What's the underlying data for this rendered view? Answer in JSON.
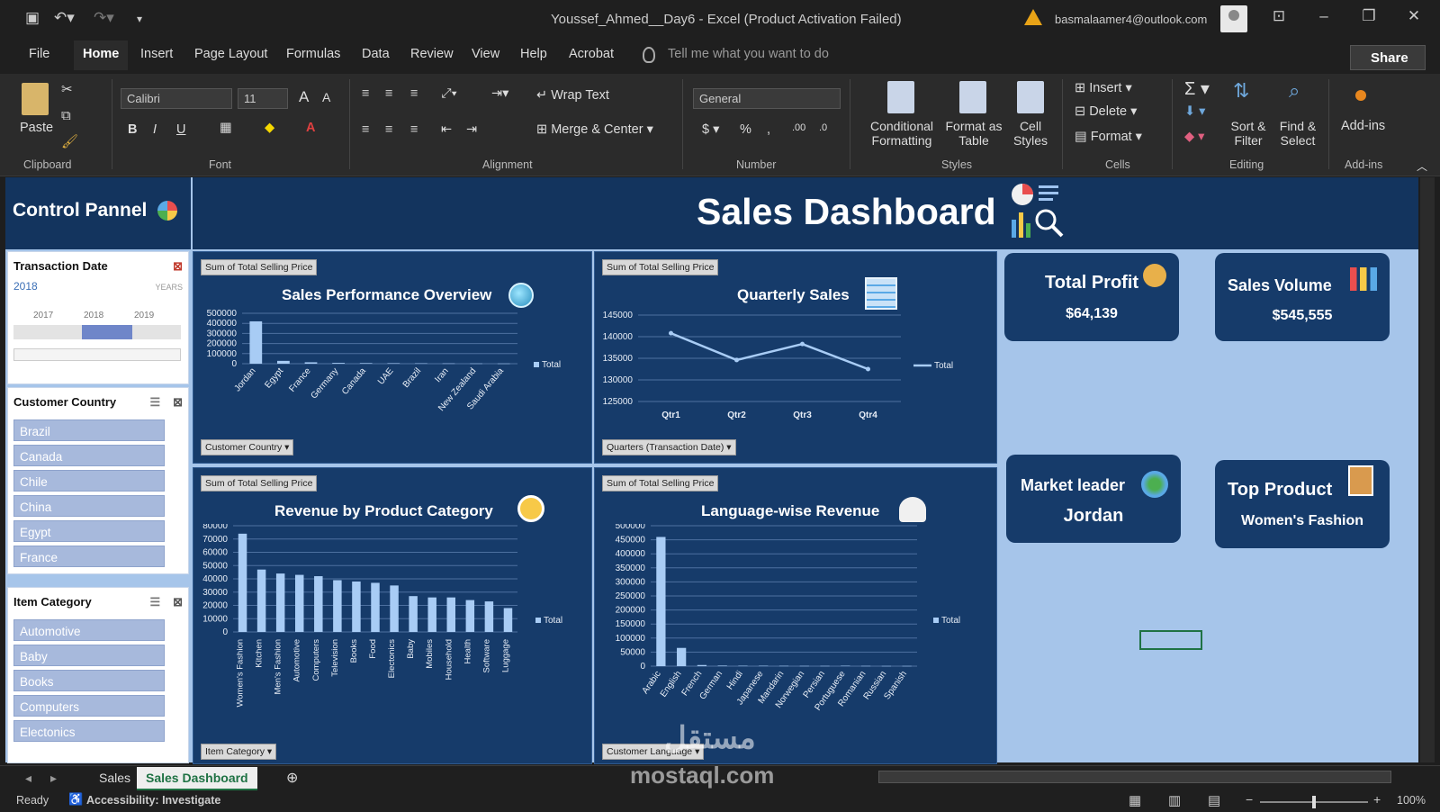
{
  "window": {
    "title": "Youssef_Ahmed__Day6  -  Excel (Product Activation Failed)",
    "account": "basmalaamer4@outlook.com",
    "share_label": "Share"
  },
  "menu_tabs": [
    "File",
    "Home",
    "Insert",
    "Page Layout",
    "Formulas",
    "Data",
    "Review",
    "View",
    "Help",
    "Acrobat"
  ],
  "tell_me_placeholder": "Tell me what you want to do",
  "ribbon": {
    "paste": "Paste",
    "font_name": "Calibri",
    "font_size": "11",
    "wrap_text": "Wrap Text",
    "merge_center": "Merge & Center",
    "number_format": "General",
    "conditional_formatting": "Conditional Formatting",
    "format_as_table": "Format as Table",
    "cell_styles": "Cell Styles",
    "insert": "Insert",
    "delete": "Delete",
    "format": "Format",
    "sort_filter": "Sort & Filter",
    "find_select": "Find & Select",
    "addins": "Add-ins",
    "groups": [
      "Clipboard",
      "Font",
      "Alignment",
      "Number",
      "Styles",
      "Cells",
      "Editing",
      "Add-ins"
    ]
  },
  "dashboard": {
    "control_panel_title": "Control Pannel",
    "title": "Sales Dashboard",
    "transaction_slicer": {
      "header": "Transaction Date",
      "selected": "2018",
      "level": "YEARS",
      "years": [
        "2017",
        "2018",
        "2019"
      ]
    },
    "country_slicer": {
      "header": "Customer Country",
      "items": [
        "Brazil",
        "Canada",
        "Chile",
        "China",
        "Egypt",
        "France"
      ]
    },
    "category_slicer": {
      "header": "Item Category",
      "items": [
        "Automotive",
        "Baby",
        "Books",
        "Computers",
        "Electonics"
      ]
    },
    "kpis": {
      "profit": {
        "title": "Total Profit",
        "value": "$64,139"
      },
      "volume": {
        "title": "Sales Volume",
        "value": "$545,555"
      },
      "leader": {
        "title": "Market leader",
        "value": "Jordan"
      },
      "product": {
        "title": "Top Product",
        "value": "Women's Fashion"
      }
    }
  },
  "chart_data": [
    {
      "type": "bar",
      "title": "Sales Performance Overview",
      "field_tag": "Sum of Total Selling Price",
      "filter_label": "Customer Country",
      "legend": "Total",
      "categories": [
        "Jordan",
        "Egypt",
        "France",
        "Germany",
        "Canada",
        "UAE",
        "Brazil",
        "Iran",
        "New Zealand",
        "Saudi Arabia"
      ],
      "values": [
        420000,
        28000,
        14000,
        8000,
        6000,
        5000,
        4000,
        3000,
        2500,
        2000
      ],
      "yticks": [
        "500000",
        "400000",
        "300000",
        "200000",
        "100000",
        "0"
      ],
      "ylim": [
        0,
        500000
      ]
    },
    {
      "type": "line",
      "title": "Quarterly Sales",
      "field_tag": "Sum of Total Selling Price",
      "filter_label": "Quarters (Transaction Date)",
      "legend": "Total",
      "categories": [
        "Qtr1",
        "Qtr2",
        "Qtr3",
        "Qtr4"
      ],
      "values": [
        140800,
        134600,
        138300,
        132500
      ],
      "yticks": [
        "145000",
        "140000",
        "135000",
        "130000",
        "125000"
      ],
      "ylim": [
        125000,
        145000
      ]
    },
    {
      "type": "bar",
      "title": "Revenue by Product Category",
      "field_tag": "Sum of Total Selling Price",
      "filter_label": "Item Category",
      "legend": "Total",
      "categories": [
        "Women's Fashion",
        "Kitchen",
        "Men's Fashion",
        "Automotive",
        "Computers",
        "Television",
        "Books",
        "Food",
        "Electonics",
        "Baby",
        "Mobiles",
        "Household",
        "Health",
        "Software",
        "Luggage"
      ],
      "values": [
        74000,
        47000,
        44000,
        43000,
        42000,
        39000,
        38000,
        37000,
        35000,
        27000,
        26000,
        26000,
        24000,
        23000,
        18000
      ],
      "yticks": [
        "80000",
        "70000",
        "60000",
        "50000",
        "40000",
        "30000",
        "20000",
        "10000",
        "0"
      ],
      "ylim": [
        0,
        80000
      ]
    },
    {
      "type": "bar",
      "title": "Language-wise Revenue",
      "field_tag": "Sum of Total Selling Price",
      "filter_label": "Customer Language",
      "legend": "Total",
      "categories": [
        "Arabic",
        "English",
        "French",
        "German",
        "Hindi",
        "Japanese",
        "Mandarin",
        "Norwegian",
        "Persian",
        "Portuguese",
        "Romanian",
        "Russian",
        "Spanish"
      ],
      "values": [
        460000,
        65000,
        4000,
        2000,
        1500,
        1500,
        1200,
        1000,
        1000,
        1500,
        1000,
        800,
        800
      ],
      "yticks": [
        "500000",
        "450000",
        "400000",
        "350000",
        "300000",
        "250000",
        "200000",
        "150000",
        "100000",
        "50000",
        "0"
      ],
      "ylim": [
        0,
        500000
      ]
    }
  ],
  "sheet_tabs": [
    "Sales",
    "Sales Dashboard"
  ],
  "status": {
    "ready": "Ready",
    "accessibility": "Accessibility: Investigate",
    "zoom": "100%"
  },
  "watermark": {
    "arabic": "مستقل",
    "url": "mostaql.com"
  }
}
